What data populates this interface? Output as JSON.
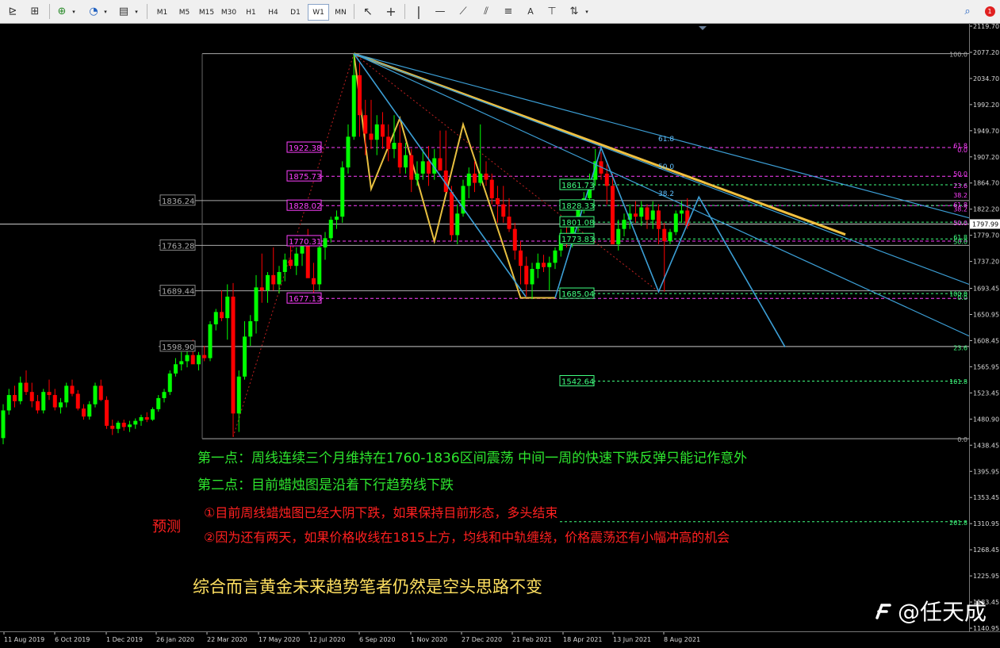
{
  "toolbar": {
    "timeframes": [
      "M1",
      "M5",
      "M15",
      "M30",
      "H1",
      "H4",
      "D1",
      "W1",
      "MN"
    ],
    "active_timeframe": "W1",
    "text_tool_label": "A",
    "notification_count": "1"
  },
  "colors": {
    "bull_candle": "#00ff00",
    "bear_candle": "#ff0000",
    "fib_line": "#3c9fd6",
    "trend_yellow": "#f0c040",
    "zigzag_yellow": "#e8c040",
    "label_magenta": "#ff40ff",
    "label_green": "#40ff80",
    "grid_gray": "#aaaaaa",
    "note_green": "#2ee62e",
    "note_red": "#ff2020",
    "note_yellow": "#ffe060"
  },
  "chart_data": {
    "type": "candlestick",
    "symbol_timeframe": "W1",
    "ylim": [
      1140.95,
      2119.7
    ],
    "y_ticks": [
      "2119.70",
      "2077.20",
      "2034.70",
      "1992.20",
      "1949.70",
      "1907.20",
      "1864.70",
      "1822.20",
      "1779.70",
      "1737.20",
      "1693.45",
      "1650.95",
      "1608.45",
      "1565.95",
      "1523.45",
      "1480.90",
      "1438.45",
      "1395.95",
      "1353.45",
      "1310.95",
      "1268.45",
      "1225.95",
      "1183.45",
      "1140.95"
    ],
    "current_price": "1797.99",
    "x_ticks": [
      "11 Aug 2019",
      "6 Oct 2019",
      "1 Dec 2019",
      "26 Jan 2020",
      "22 Mar 2020",
      "17 May 2020",
      "12 Jul 2020",
      "6 Sep 2020",
      "1 Nov 2020",
      "27 Dec 2020",
      "21 Feb 2021",
      "18 Apr 2021",
      "13 Jun 2021",
      "8 Aug 2021"
    ],
    "levels_left": [
      {
        "label": "1836.24",
        "price": 1836.24
      },
      {
        "label": "1763.28",
        "price": 1763.28
      },
      {
        "label": "1689.44",
        "price": 1689.44
      },
      {
        "label": "1598.90",
        "price": 1598.9
      }
    ],
    "levels_magenta": [
      {
        "label": "1922.38",
        "price": 1922.38
      },
      {
        "label": "1875.73",
        "price": 1875.73
      },
      {
        "label": "1828.02",
        "price": 1828.02
      },
      {
        "label": "1770.31",
        "price": 1770.31
      },
      {
        "label": "1677.13",
        "price": 1677.13
      }
    ],
    "levels_green": [
      {
        "label": "1861.73",
        "price": 1861.73
      },
      {
        "label": "1828.33",
        "price": 1828.33
      },
      {
        "label": "1801.08",
        "price": 1801.08
      },
      {
        "label": "1773.83",
        "price": 1773.83
      },
      {
        "label": "1685.04",
        "price": 1685.04
      },
      {
        "label": "1542.64",
        "price": 1542.64
      }
    ],
    "fib_right_labels": [
      {
        "label": "100.0",
        "price": 2075
      },
      {
        "label": "61.8",
        "price": 1927
      },
      {
        "label": "0.0",
        "price": 1920
      },
      {
        "label": "50.0",
        "price": 1881
      },
      {
        "label": "23.6",
        "price": 1862
      },
      {
        "label": "38.2",
        "price": 1846
      },
      {
        "label": "61.8",
        "price": 1831
      },
      {
        "label": "38.2",
        "price": 1824
      },
      {
        "label": "50.0",
        "price": 1801
      },
      {
        "label": "61.8",
        "price": 1778
      },
      {
        "label": "50.0",
        "price": 1771
      },
      {
        "label": "100.0",
        "price": 1686
      },
      {
        "label": "0.0",
        "price": 1680
      },
      {
        "label": "23.6",
        "price": 1598
      },
      {
        "label": "161.8",
        "price": 1543
      },
      {
        "label": "0.0",
        "price": 1449
      },
      {
        "label": "261.8",
        "price": 1314
      }
    ],
    "fan_labels": [
      {
        "label": "61.8",
        "price": 1938
      },
      {
        "label": "50.0",
        "price": 1893
      },
      {
        "label": "38.2",
        "price": 1849
      }
    ],
    "candles": [
      [
        1450,
        1505,
        1440,
        1495
      ],
      [
        1495,
        1530,
        1488,
        1520
      ],
      [
        1520,
        1535,
        1500,
        1510
      ],
      [
        1510,
        1550,
        1505,
        1540
      ],
      [
        1540,
        1560,
        1520,
        1525
      ],
      [
        1525,
        1540,
        1500,
        1510
      ],
      [
        1510,
        1520,
        1490,
        1495
      ],
      [
        1495,
        1530,
        1490,
        1525
      ],
      [
        1525,
        1545,
        1512,
        1520
      ],
      [
        1520,
        1530,
        1495,
        1500
      ],
      [
        1500,
        1515,
        1490,
        1508
      ],
      [
        1508,
        1540,
        1500,
        1535
      ],
      [
        1535,
        1545,
        1518,
        1522
      ],
      [
        1522,
        1528,
        1495,
        1498
      ],
      [
        1498,
        1505,
        1480,
        1485
      ],
      [
        1485,
        1510,
        1480,
        1505
      ],
      [
        1505,
        1540,
        1500,
        1535
      ],
      [
        1535,
        1545,
        1510,
        1512
      ],
      [
        1512,
        1518,
        1465,
        1470
      ],
      [
        1470,
        1480,
        1455,
        1465
      ],
      [
        1465,
        1478,
        1458,
        1475
      ],
      [
        1475,
        1480,
        1462,
        1468
      ],
      [
        1468,
        1478,
        1460,
        1472
      ],
      [
        1472,
        1482,
        1465,
        1478
      ],
      [
        1478,
        1488,
        1470,
        1484
      ],
      [
        1484,
        1492,
        1476,
        1480
      ],
      [
        1480,
        1500,
        1478,
        1497
      ],
      [
        1497,
        1520,
        1493,
        1515
      ],
      [
        1515,
        1530,
        1508,
        1525
      ],
      [
        1525,
        1560,
        1520,
        1555
      ],
      [
        1555,
        1580,
        1550,
        1570
      ],
      [
        1570,
        1590,
        1560,
        1575
      ],
      [
        1575,
        1595,
        1565,
        1585
      ],
      [
        1585,
        1610,
        1575,
        1570
      ],
      [
        1570,
        1590,
        1560,
        1585
      ],
      [
        1585,
        1600,
        1575,
        1580
      ],
      [
        1580,
        1640,
        1575,
        1635
      ],
      [
        1635,
        1660,
        1625,
        1655
      ],
      [
        1655,
        1690,
        1640,
        1645
      ],
      [
        1645,
        1700,
        1610,
        1680
      ],
      [
        1680,
        1702,
        1452,
        1490
      ],
      [
        1490,
        1560,
        1460,
        1550
      ],
      [
        1550,
        1640,
        1545,
        1615
      ],
      [
        1615,
        1650,
        1600,
        1640
      ],
      [
        1640,
        1715,
        1620,
        1695
      ],
      [
        1695,
        1750,
        1670,
        1690
      ],
      [
        1690,
        1720,
        1670,
        1715
      ],
      [
        1715,
        1760,
        1690,
        1700
      ],
      [
        1700,
        1730,
        1685,
        1720
      ],
      [
        1720,
        1750,
        1705,
        1740
      ],
      [
        1740,
        1770,
        1725,
        1730
      ],
      [
        1730,
        1760,
        1715,
        1750
      ],
      [
        1750,
        1770,
        1730,
        1765
      ],
      [
        1765,
        1790,
        1740,
        1710
      ],
      [
        1710,
        1735,
        1680,
        1700
      ],
      [
        1700,
        1770,
        1690,
        1760
      ],
      [
        1760,
        1785,
        1740,
        1775
      ],
      [
        1775,
        1810,
        1768,
        1805
      ],
      [
        1805,
        1820,
        1790,
        1810
      ],
      [
        1810,
        1900,
        1800,
        1890
      ],
      [
        1890,
        1960,
        1880,
        1940
      ],
      [
        1940,
        2075,
        1935,
        2040
      ],
      [
        2040,
        2060,
        1940,
        1975
      ],
      [
        1975,
        2000,
        1910,
        1945
      ],
      [
        1945,
        2000,
        1920,
        1935
      ],
      [
        1935,
        1975,
        1910,
        1960
      ],
      [
        1960,
        1980,
        1920,
        1940
      ],
      [
        1940,
        1960,
        1900,
        1920
      ],
      [
        1920,
        1975,
        1905,
        1930
      ],
      [
        1930,
        1960,
        1880,
        1890
      ],
      [
        1890,
        1930,
        1880,
        1910
      ],
      [
        1910,
        1920,
        1850,
        1870
      ],
      [
        1870,
        1900,
        1860,
        1880
      ],
      [
        1880,
        1920,
        1870,
        1900
      ],
      [
        1900,
        1925,
        1860,
        1880
      ],
      [
        1880,
        1920,
        1870,
        1905
      ],
      [
        1905,
        1950,
        1895,
        1885
      ],
      [
        1885,
        1950,
        1870,
        1850
      ],
      [
        1850,
        1860,
        1770,
        1780
      ],
      [
        1780,
        1830,
        1765,
        1815
      ],
      [
        1815,
        1870,
        1810,
        1860
      ],
      [
        1860,
        1890,
        1840,
        1880
      ],
      [
        1880,
        1900,
        1850,
        1865
      ],
      [
        1865,
        1960,
        1860,
        1880
      ],
      [
        1880,
        1900,
        1860,
        1870
      ],
      [
        1870,
        1880,
        1830,
        1840
      ],
      [
        1840,
        1860,
        1800,
        1830
      ],
      [
        1830,
        1860,
        1800,
        1810
      ],
      [
        1810,
        1840,
        1785,
        1790
      ],
      [
        1790,
        1800,
        1740,
        1755
      ],
      [
        1755,
        1770,
        1700,
        1730
      ],
      [
        1730,
        1745,
        1680,
        1700
      ],
      [
        1700,
        1735,
        1676,
        1725
      ],
      [
        1725,
        1750,
        1710,
        1735
      ],
      [
        1735,
        1748,
        1720,
        1728
      ],
      [
        1728,
        1745,
        1690,
        1735
      ],
      [
        1735,
        1760,
        1725,
        1755
      ],
      [
        1755,
        1790,
        1745,
        1780
      ],
      [
        1780,
        1800,
        1760,
        1775
      ],
      [
        1775,
        1800,
        1760,
        1795
      ],
      [
        1795,
        1830,
        1785,
        1825
      ],
      [
        1825,
        1850,
        1815,
        1840
      ],
      [
        1840,
        1880,
        1830,
        1870
      ],
      [
        1870,
        1920,
        1860,
        1900
      ],
      [
        1900,
        1915,
        1870,
        1880
      ],
      [
        1880,
        1895,
        1830,
        1860
      ],
      [
        1860,
        1880,
        1765,
        1765
      ],
      [
        1765,
        1805,
        1755,
        1790
      ],
      [
        1790,
        1815,
        1778,
        1805
      ],
      [
        1805,
        1830,
        1790,
        1815
      ],
      [
        1815,
        1835,
        1800,
        1810
      ],
      [
        1810,
        1835,
        1795,
        1825
      ],
      [
        1825,
        1830,
        1790,
        1805
      ],
      [
        1805,
        1835,
        1790,
        1820
      ],
      [
        1820,
        1830,
        1765,
        1790
      ],
      [
        1790,
        1800,
        1688,
        1770
      ],
      [
        1770,
        1790,
        1765,
        1785
      ],
      [
        1785,
        1820,
        1780,
        1815
      ],
      [
        1815,
        1835,
        1800,
        1820
      ],
      [
        1820,
        1840,
        1790,
        1795
      ]
    ]
  },
  "notes": {
    "point1": "第一点：周线连续三个月维持在1760-1836区间震荡  中间一周的快速下跌反弹只能记作意外",
    "point2": "第二点：目前蜡烛图是沿着下行趋势线下跌",
    "forecast_label": "预测",
    "forecast1": "①目前周线蜡烛图已经大阴下跌，如果保持目前形态，多头结束",
    "forecast2": "②因为还有两天，如果价格收线在1815上方，均线和中轨缠绕，价格震荡还有小幅冲高的机会",
    "conclusion": "综合而言黄金未来趋势笔者仍然是空头思路不变"
  },
  "watermark": "@任天成"
}
